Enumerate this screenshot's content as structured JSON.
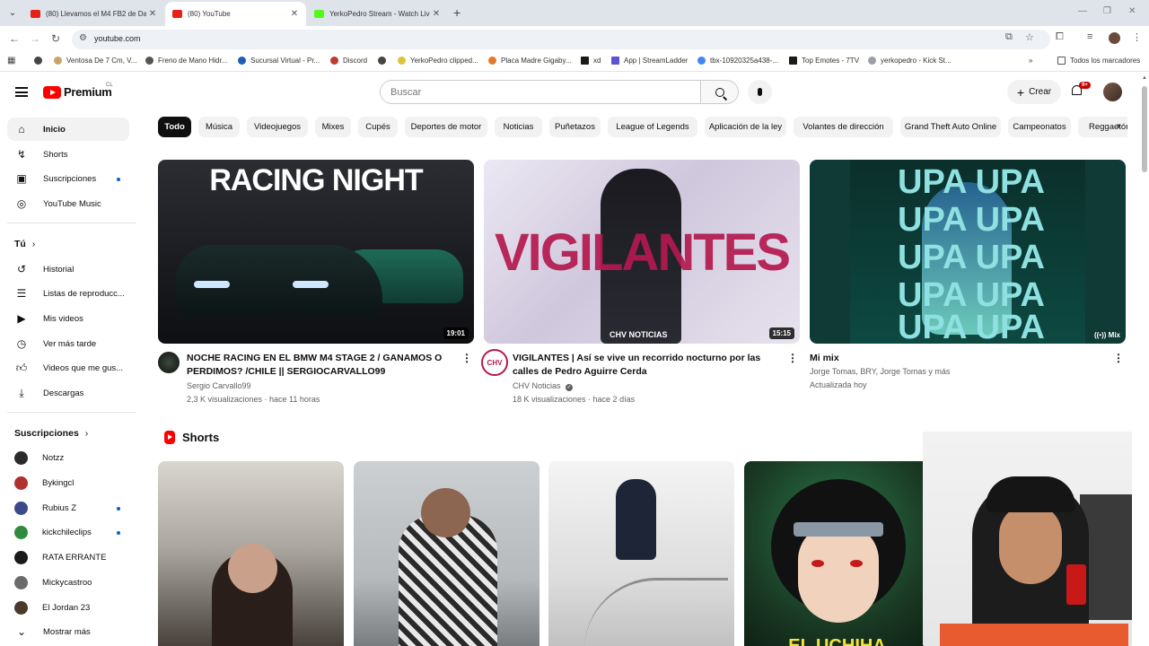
{
  "browser": {
    "tabs": [
      {
        "title": "(80) Llevamos el M4 FB2 de Da",
        "favicon": "youtube-favicon",
        "active": false
      },
      {
        "title": "(80) YouTube",
        "favicon": "youtube-favicon",
        "active": true
      },
      {
        "title": "YerkoPedro Stream - Watch Live",
        "favicon": "kick-favicon",
        "active": false
      }
    ],
    "url": "youtube.com",
    "bookmarks": [
      "Ventosa De 7 Cm, V...",
      "Freno de Mano Hidr...",
      "Sucursal Virtual - Pr...",
      "Discord",
      "YerkoPedro clipped...",
      "Placa Madre Gigaby...",
      "xd",
      "App | StreamLadder",
      "tbx-10920325a438-...",
      "Top Emotes - 7TV",
      "yerkopedro - Kick St..."
    ],
    "bookmarks_folder": "Todos los marcadores"
  },
  "yt": {
    "logo_text": "Premium",
    "country_code": "CL",
    "search_placeholder": "Buscar",
    "create_label": "Crear",
    "notification_badge": "9+"
  },
  "sidebar": {
    "main": [
      {
        "label": "Inicio",
        "icon": "home-icon",
        "active": true,
        "dot": false
      },
      {
        "label": "Shorts",
        "icon": "shorts-icon",
        "active": false,
        "dot": false
      },
      {
        "label": "Suscripciones",
        "icon": "subscriptions-icon",
        "active": false,
        "dot": true
      },
      {
        "label": "YouTube Music",
        "icon": "music-icon",
        "active": false,
        "dot": false
      }
    ],
    "you_title": "Tú",
    "you": [
      {
        "label": "Historial",
        "icon": "history-icon"
      },
      {
        "label": "Listas de reproducc...",
        "icon": "playlist-icon"
      },
      {
        "label": "Mis videos",
        "icon": "my-videos-icon"
      },
      {
        "label": "Ver más tarde",
        "icon": "clock-icon"
      },
      {
        "label": "Videos que me gus...",
        "icon": "like-icon"
      },
      {
        "label": "Descargas",
        "icon": "download-icon"
      }
    ],
    "subs_title": "Suscripciones",
    "subs": [
      {
        "label": "Notzz",
        "color": "#2b2b2b",
        "dot": false
      },
      {
        "label": "Bykingcl",
        "color": "#b03030",
        "dot": false
      },
      {
        "label": "Rubius Z",
        "color": "#3b4a8a",
        "dot": true
      },
      {
        "label": "kickchileclips",
        "color": "#2f8a3e",
        "dot": true
      },
      {
        "label": "RATA ERRANTE",
        "color": "#1a1a1a",
        "dot": false
      },
      {
        "label": "Mickycastroo",
        "color": "#6b6b6b",
        "dot": false
      },
      {
        "label": "El Jordan 23",
        "color": "#4a3a2a",
        "dot": false
      }
    ],
    "show_more": "Mostrar más"
  },
  "chips": [
    "Todo",
    "Música",
    "Videojuegos",
    "Mixes",
    "Cupés",
    "Deportes de motor",
    "Noticias",
    "Puñetazos",
    "League of Legends",
    "Aplicación de la ley",
    "Volantes de dirección",
    "Grand Theft Auto Online",
    "Campeonatos",
    "Reggaetón"
  ],
  "videos": [
    {
      "title": "NOCHE RACING EN EL BMW M4 STAGE 2 / GANAMOS O PERDIMOS? /CHILE || SERGIOCARVALLO99",
      "channel": "Sergio Carvallo99",
      "meta": "2,3 K visualizaciones · hace 11 horas",
      "duration": "19:01",
      "thumb_text": "RACING NIGHT"
    },
    {
      "title": "VIGILANTES | Así se vive un recorrido nocturno por las calles de Pedro Aguirre Cerda",
      "channel": "CHV Noticias",
      "meta": "18 K visualizaciones · hace 2 días",
      "duration": "15:15",
      "thumb_text": "VIGILANTES",
      "thumb_brand": "CHV NOTICIAS",
      "avatar_text": "CHV"
    },
    {
      "title": "Mi mix",
      "channel": "Jorge Tomas, BRY, Jorge Tomas y más",
      "meta": "Actualizada hoy",
      "badge": "Mix",
      "thumb_text": "UPA UPA"
    }
  ],
  "shorts": {
    "title": "Shorts",
    "items": [
      {
        "thumb_text": ""
      },
      {
        "thumb_text": ""
      },
      {
        "thumb_text": ""
      },
      {
        "thumb_text": "EL UCHIHA"
      }
    ]
  }
}
